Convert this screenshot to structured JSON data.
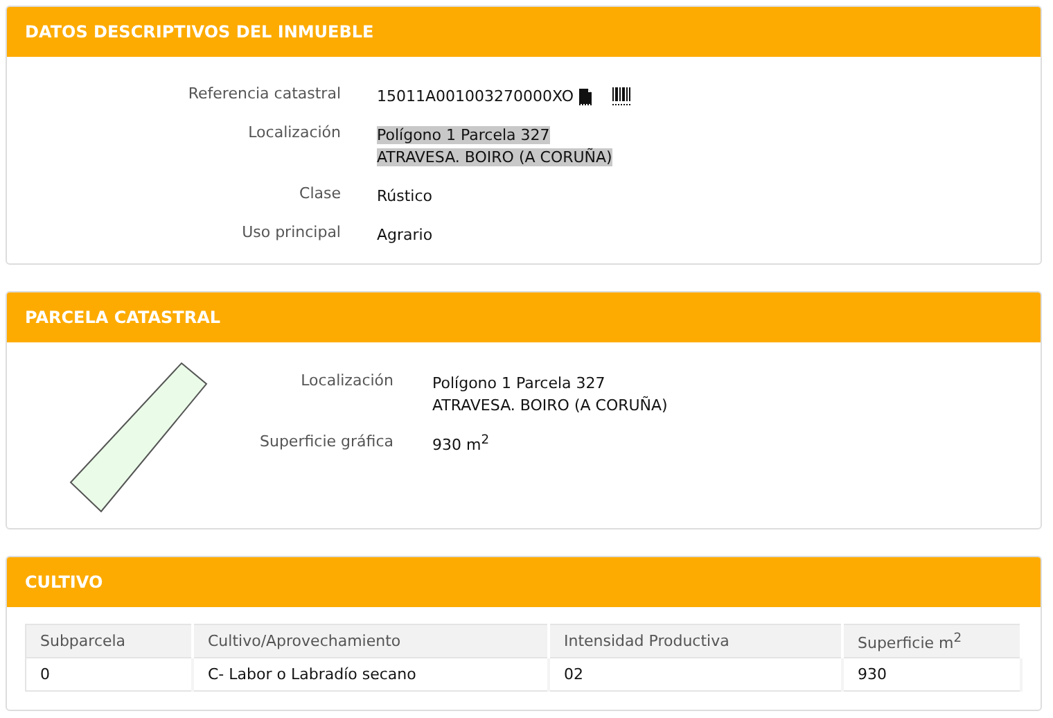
{
  "inmueble": {
    "title": "DATOS DESCRIPTIVOS DEL INMUEBLE",
    "fields": [
      {
        "label": "Referencia catastral",
        "lines": [
          "15011A001003270000XO"
        ],
        "highlighted": false,
        "kind": "reference"
      },
      {
        "label": "Localización",
        "lines": [
          "Polígono 1 Parcela 327",
          "ATRAVESA. BOIRO (A CORUÑA)"
        ],
        "highlighted": true,
        "kind": "text"
      },
      {
        "label": "Clase",
        "lines": [
          "Rústico"
        ],
        "highlighted": false,
        "kind": "text"
      },
      {
        "label": "Uso principal",
        "lines": [
          "Agrario"
        ],
        "highlighted": false,
        "kind": "text"
      }
    ]
  },
  "parcela": {
    "title": "PARCELA CATASTRAL",
    "fields": [
      {
        "label": "Localización",
        "lines": [
          "Polígono 1 Parcela 327",
          "ATRAVESA. BOIRO (A CORUÑA)"
        ]
      },
      {
        "label": "Superficie gráfica",
        "lines": [
          "930 m$^{2}$"
        ]
      }
    ]
  },
  "cultivo": {
    "title": "CULTIVO",
    "columns": [
      "Subparcela",
      "Cultivo/Aprovechamiento",
      "Intensidad Productiva",
      "Superficie m$^{2}$"
    ],
    "rows": [
      [
        "0",
        "C- Labor o Labradío secano",
        "02",
        "930"
      ]
    ]
  }
}
